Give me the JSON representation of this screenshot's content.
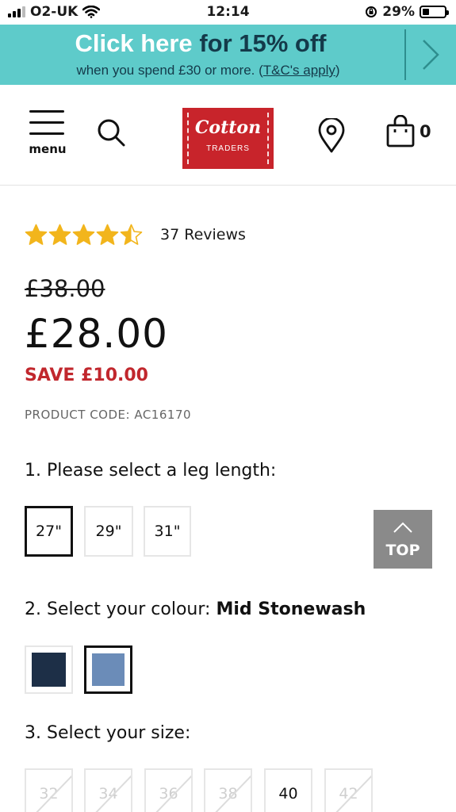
{
  "status_bar": {
    "carrier": "O2-UK",
    "time": "12:14",
    "battery": "29%",
    "battery_level": 0.29
  },
  "promo": {
    "highlight": "Click here",
    "title_rest": "for 15% off",
    "subtitle": "when you spend £30 or more. (",
    "terms_link": "T&C's apply",
    "subtitle_end": ")",
    "color": "#5ecbca"
  },
  "header": {
    "menu_label": "menu",
    "logo_main": "Cotton",
    "logo_sub": "TRADERS",
    "cart_count": "0",
    "brand_color": "#c8242b"
  },
  "product": {
    "rating": 4.5,
    "review_count": "37 Reviews",
    "old_price": "£38.00",
    "price": "£28.00",
    "save": "SAVE £10.00",
    "product_code": "PRODUCT CODE: AC16170"
  },
  "leg_length": {
    "label": "1. Please select a leg length:",
    "options": [
      {
        "label": "27\"",
        "selected": true
      },
      {
        "label": "29\"",
        "selected": false
      },
      {
        "label": "31\"",
        "selected": false
      }
    ]
  },
  "colour": {
    "label": "2. Select your colour: ",
    "selected_name": "Mid Stonewash",
    "swatches": [
      {
        "color": "#1d2f47",
        "selected": false
      },
      {
        "color": "#6b8cb8",
        "selected": true
      }
    ]
  },
  "size": {
    "label": "3. Select your size:",
    "options": [
      {
        "label": "32",
        "available": false
      },
      {
        "label": "34",
        "available": false
      },
      {
        "label": "36",
        "available": false
      },
      {
        "label": "38",
        "available": false
      },
      {
        "label": "40",
        "available": true
      },
      {
        "label": "42",
        "available": false
      }
    ]
  },
  "back_to_top": {
    "label": "TOP"
  }
}
